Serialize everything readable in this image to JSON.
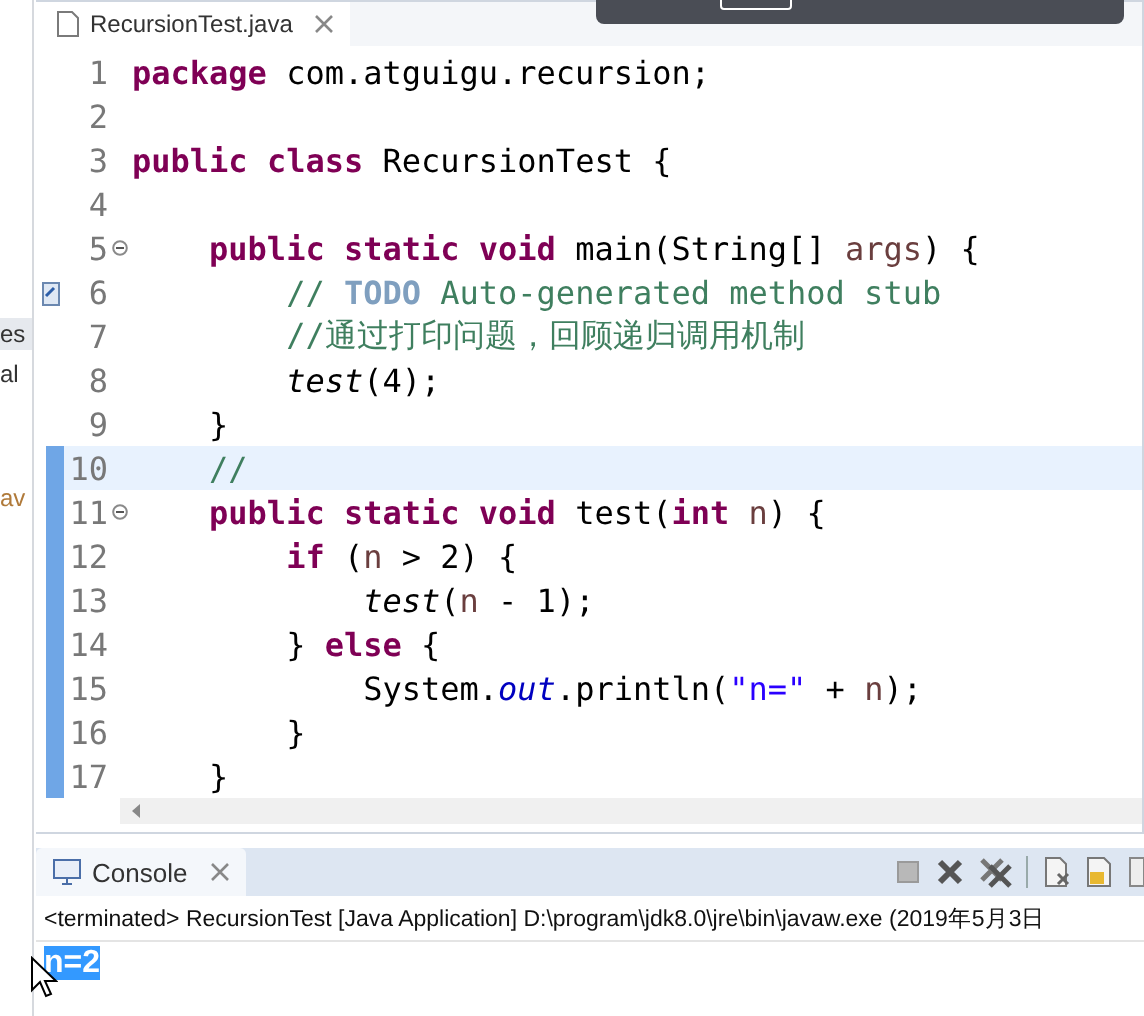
{
  "sidebar_fragments": [
    "es",
    "al",
    "av"
  ],
  "editor": {
    "tab": {
      "label": "RecursionTest.java"
    },
    "lines": [
      {
        "number": "1",
        "fold": false,
        "changed": false,
        "current": false,
        "marker": false,
        "tokens": [
          {
            "kind": "keyword",
            "text": "package "
          },
          {
            "kind": "plain",
            "text": "com.atguigu.recursion;"
          }
        ]
      },
      {
        "number": "2",
        "fold": false,
        "changed": false,
        "current": false,
        "marker": false
      },
      {
        "number": "3",
        "fold": false,
        "changed": false,
        "current": false,
        "marker": false,
        "tokens": [
          {
            "kind": "keyword",
            "text": "public "
          },
          {
            "kind": "keyword",
            "text": "class "
          },
          {
            "kind": "plain",
            "text": "RecursionTest {"
          }
        ]
      },
      {
        "number": "4",
        "fold": false,
        "changed": false,
        "current": false,
        "marker": false
      },
      {
        "number": "5",
        "fold": true,
        "changed": false,
        "current": false,
        "marker": false,
        "tokens": [
          {
            "kind": "keyword",
            "text": "    public "
          },
          {
            "kind": "keyword",
            "text": "static "
          },
          {
            "kind": "keyword",
            "text": "void "
          },
          {
            "kind": "plain",
            "text": "main(String[] "
          },
          {
            "kind": "param",
            "text": "args"
          },
          {
            "kind": "plain",
            "text": ") {"
          }
        ]
      },
      {
        "number": "6",
        "fold": false,
        "changed": false,
        "current": false,
        "marker": true,
        "tokens": [
          {
            "kind": "comment",
            "text": "        // "
          },
          {
            "kind": "todo",
            "text": "TODO"
          },
          {
            "kind": "comment",
            "text": " Auto-generated method stub"
          }
        ]
      },
      {
        "number": "7",
        "fold": false,
        "changed": false,
        "current": false,
        "marker": false,
        "tokens": [
          {
            "kind": "comment",
            "text": "        //通过打印问题，回顾递归调用机制"
          }
        ]
      },
      {
        "number": "8",
        "fold": false,
        "changed": false,
        "current": false,
        "marker": false,
        "tokens": [
          {
            "kind": "static-call",
            "text": "        test"
          },
          {
            "kind": "plain",
            "text": "(4);"
          }
        ]
      },
      {
        "number": "9",
        "fold": false,
        "changed": false,
        "current": false,
        "marker": false,
        "tokens": [
          {
            "kind": "plain",
            "text": "    }"
          }
        ]
      },
      {
        "number": "10",
        "fold": false,
        "changed": true,
        "current": true,
        "marker": false,
        "tokens": [
          {
            "kind": "comment",
            "text": "    //"
          }
        ]
      },
      {
        "number": "11",
        "fold": true,
        "changed": true,
        "current": false,
        "marker": false,
        "tokens": [
          {
            "kind": "keyword",
            "text": "    public "
          },
          {
            "kind": "keyword",
            "text": "static "
          },
          {
            "kind": "keyword",
            "text": "void "
          },
          {
            "kind": "plain",
            "text": "test("
          },
          {
            "kind": "keyword",
            "text": "int "
          },
          {
            "kind": "param",
            "text": "n"
          },
          {
            "kind": "plain",
            "text": ") {"
          }
        ]
      },
      {
        "number": "12",
        "fold": false,
        "changed": true,
        "current": false,
        "marker": false,
        "tokens": [
          {
            "kind": "keyword",
            "text": "        if"
          },
          {
            "kind": "plain",
            "text": " ("
          },
          {
            "kind": "param",
            "text": "n"
          },
          {
            "kind": "plain",
            "text": " > 2) {"
          }
        ]
      },
      {
        "number": "13",
        "fold": false,
        "changed": true,
        "current": false,
        "marker": false,
        "tokens": [
          {
            "kind": "static-call",
            "text": "            test"
          },
          {
            "kind": "plain",
            "text": "("
          },
          {
            "kind": "param",
            "text": "n"
          },
          {
            "kind": "plain",
            "text": " - 1);"
          }
        ]
      },
      {
        "number": "14",
        "fold": false,
        "changed": true,
        "current": false,
        "marker": false,
        "tokens": [
          {
            "kind": "plain",
            "text": "        } "
          },
          {
            "kind": "keyword",
            "text": "else"
          },
          {
            "kind": "plain",
            "text": " {"
          }
        ]
      },
      {
        "number": "15",
        "fold": false,
        "changed": true,
        "current": false,
        "marker": false,
        "tokens": [
          {
            "kind": "plain",
            "text": "            System."
          },
          {
            "kind": "field",
            "text": "out"
          },
          {
            "kind": "plain",
            "text": ".println("
          },
          {
            "kind": "string",
            "text": "\"n=\""
          },
          {
            "kind": "plain",
            "text": " + "
          },
          {
            "kind": "param",
            "text": "n"
          },
          {
            "kind": "plain",
            "text": ");"
          }
        ]
      },
      {
        "number": "16",
        "fold": false,
        "changed": true,
        "current": false,
        "marker": false,
        "tokens": [
          {
            "kind": "plain",
            "text": "        }"
          }
        ]
      },
      {
        "number": "17",
        "fold": false,
        "changed": true,
        "current": false,
        "marker": false,
        "tokens": [
          {
            "kind": "plain",
            "text": "    }"
          }
        ]
      }
    ]
  },
  "console": {
    "tab": {
      "label": "Console"
    },
    "header": "<terminated> RecursionTest [Java Application] D:\\program\\jdk8.0\\jre\\bin\\javaw.exe (2019年5月3日",
    "output": [
      {
        "text": "n=2",
        "selected": true
      }
    ]
  }
}
